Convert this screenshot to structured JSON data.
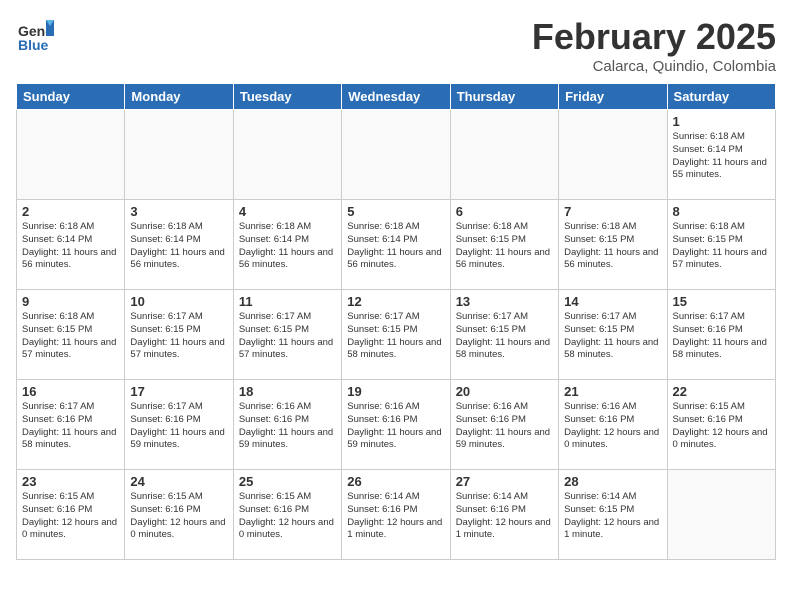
{
  "header": {
    "logo_general": "General",
    "logo_blue": "Blue",
    "title": "February 2025",
    "subtitle": "Calarca, Quindio, Colombia"
  },
  "days_of_week": [
    "Sunday",
    "Monday",
    "Tuesday",
    "Wednesday",
    "Thursday",
    "Friday",
    "Saturday"
  ],
  "weeks": [
    [
      {
        "day": "",
        "info": ""
      },
      {
        "day": "",
        "info": ""
      },
      {
        "day": "",
        "info": ""
      },
      {
        "day": "",
        "info": ""
      },
      {
        "day": "",
        "info": ""
      },
      {
        "day": "",
        "info": ""
      },
      {
        "day": "1",
        "info": "Sunrise: 6:18 AM\nSunset: 6:14 PM\nDaylight: 11 hours and 55 minutes."
      }
    ],
    [
      {
        "day": "2",
        "info": "Sunrise: 6:18 AM\nSunset: 6:14 PM\nDaylight: 11 hours and 56 minutes."
      },
      {
        "day": "3",
        "info": "Sunrise: 6:18 AM\nSunset: 6:14 PM\nDaylight: 11 hours and 56 minutes."
      },
      {
        "day": "4",
        "info": "Sunrise: 6:18 AM\nSunset: 6:14 PM\nDaylight: 11 hours and 56 minutes."
      },
      {
        "day": "5",
        "info": "Sunrise: 6:18 AM\nSunset: 6:14 PM\nDaylight: 11 hours and 56 minutes."
      },
      {
        "day": "6",
        "info": "Sunrise: 6:18 AM\nSunset: 6:15 PM\nDaylight: 11 hours and 56 minutes."
      },
      {
        "day": "7",
        "info": "Sunrise: 6:18 AM\nSunset: 6:15 PM\nDaylight: 11 hours and 56 minutes."
      },
      {
        "day": "8",
        "info": "Sunrise: 6:18 AM\nSunset: 6:15 PM\nDaylight: 11 hours and 57 minutes."
      }
    ],
    [
      {
        "day": "9",
        "info": "Sunrise: 6:18 AM\nSunset: 6:15 PM\nDaylight: 11 hours and 57 minutes."
      },
      {
        "day": "10",
        "info": "Sunrise: 6:17 AM\nSunset: 6:15 PM\nDaylight: 11 hours and 57 minutes."
      },
      {
        "day": "11",
        "info": "Sunrise: 6:17 AM\nSunset: 6:15 PM\nDaylight: 11 hours and 57 minutes."
      },
      {
        "day": "12",
        "info": "Sunrise: 6:17 AM\nSunset: 6:15 PM\nDaylight: 11 hours and 58 minutes."
      },
      {
        "day": "13",
        "info": "Sunrise: 6:17 AM\nSunset: 6:15 PM\nDaylight: 11 hours and 58 minutes."
      },
      {
        "day": "14",
        "info": "Sunrise: 6:17 AM\nSunset: 6:15 PM\nDaylight: 11 hours and 58 minutes."
      },
      {
        "day": "15",
        "info": "Sunrise: 6:17 AM\nSunset: 6:16 PM\nDaylight: 11 hours and 58 minutes."
      }
    ],
    [
      {
        "day": "16",
        "info": "Sunrise: 6:17 AM\nSunset: 6:16 PM\nDaylight: 11 hours and 58 minutes."
      },
      {
        "day": "17",
        "info": "Sunrise: 6:17 AM\nSunset: 6:16 PM\nDaylight: 11 hours and 59 minutes."
      },
      {
        "day": "18",
        "info": "Sunrise: 6:16 AM\nSunset: 6:16 PM\nDaylight: 11 hours and 59 minutes."
      },
      {
        "day": "19",
        "info": "Sunrise: 6:16 AM\nSunset: 6:16 PM\nDaylight: 11 hours and 59 minutes."
      },
      {
        "day": "20",
        "info": "Sunrise: 6:16 AM\nSunset: 6:16 PM\nDaylight: 11 hours and 59 minutes."
      },
      {
        "day": "21",
        "info": "Sunrise: 6:16 AM\nSunset: 6:16 PM\nDaylight: 12 hours and 0 minutes."
      },
      {
        "day": "22",
        "info": "Sunrise: 6:15 AM\nSunset: 6:16 PM\nDaylight: 12 hours and 0 minutes."
      }
    ],
    [
      {
        "day": "23",
        "info": "Sunrise: 6:15 AM\nSunset: 6:16 PM\nDaylight: 12 hours and 0 minutes."
      },
      {
        "day": "24",
        "info": "Sunrise: 6:15 AM\nSunset: 6:16 PM\nDaylight: 12 hours and 0 minutes."
      },
      {
        "day": "25",
        "info": "Sunrise: 6:15 AM\nSunset: 6:16 PM\nDaylight: 12 hours and 0 minutes."
      },
      {
        "day": "26",
        "info": "Sunrise: 6:14 AM\nSunset: 6:16 PM\nDaylight: 12 hours and 1 minute."
      },
      {
        "day": "27",
        "info": "Sunrise: 6:14 AM\nSunset: 6:16 PM\nDaylight: 12 hours and 1 minute."
      },
      {
        "day": "28",
        "info": "Sunrise: 6:14 AM\nSunset: 6:15 PM\nDaylight: 12 hours and 1 minute."
      },
      {
        "day": "",
        "info": ""
      }
    ]
  ]
}
